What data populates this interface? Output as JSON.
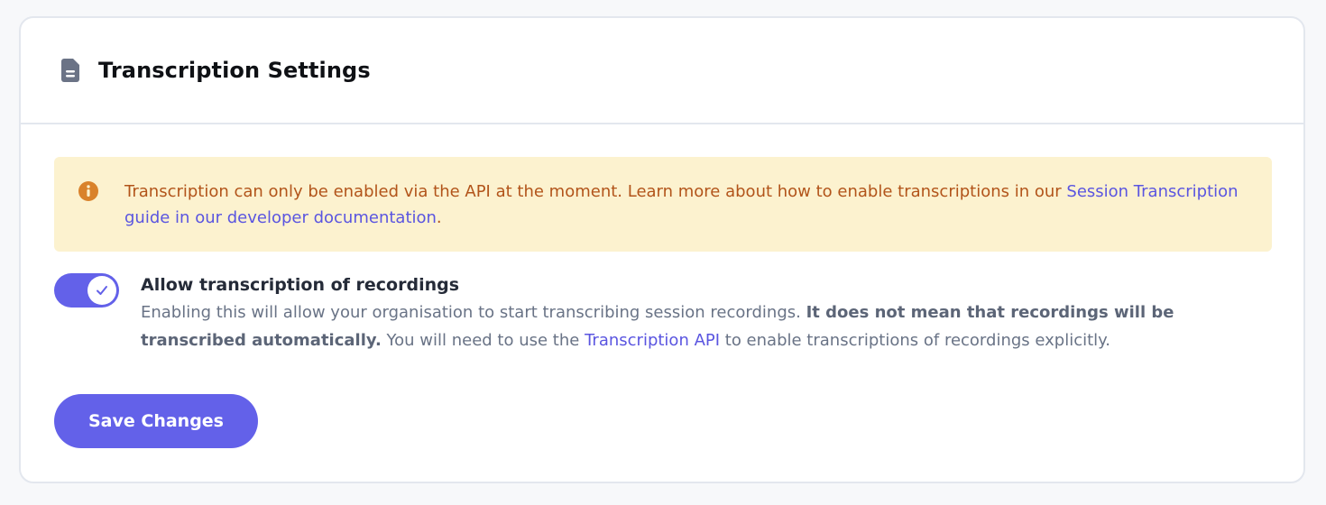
{
  "header": {
    "icon": "document-icon",
    "title": "Transcription Settings"
  },
  "alert": {
    "icon": "info-icon",
    "text": "Transcription can only be enabled via the API at the moment. Learn more about how to enable transcriptions in our ",
    "link_text": "Session Transcription guide in our developer documentation",
    "text_end": "."
  },
  "toggle": {
    "enabled": true,
    "label": "Allow transcription of recordings",
    "desc_part1": "Enabling this will allow your organisation to start transcribing session recordings. ",
    "desc_bold": "It does not mean that recordings will be transcribed automatically.",
    "desc_part2": " You will need to use the ",
    "desc_link": "Transcription API",
    "desc_part3": " to enable transcriptions of recordings explicitly."
  },
  "actions": {
    "save_label": "Save Changes"
  },
  "colors": {
    "accent": "#6361e9",
    "alert_bg": "#fcf2cf",
    "alert_text": "#b2541a",
    "link": "#5a55e0",
    "info_icon": "#d9822b"
  }
}
